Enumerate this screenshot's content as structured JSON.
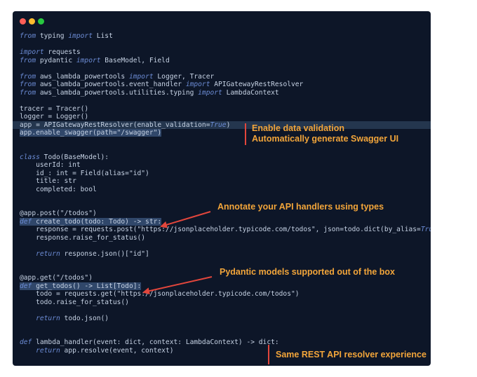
{
  "colors": {
    "red_dot": "#ff5f57",
    "yellow_dot": "#febc2e",
    "green_dot": "#28c840",
    "annotation": "#f2a53a",
    "marker": "#e2463c"
  },
  "code_lines": [
    {
      "segs": [
        [
          "from",
          "kw"
        ],
        [
          " typing ",
          ""
        ],
        [
          "import",
          "kw"
        ],
        [
          " List",
          ""
        ]
      ]
    },
    {
      "segs": []
    },
    {
      "segs": [
        [
          "import",
          "kw"
        ],
        [
          " requests",
          ""
        ]
      ]
    },
    {
      "segs": [
        [
          "from",
          "kw"
        ],
        [
          " pydantic ",
          ""
        ],
        [
          "import",
          "kw"
        ],
        [
          " BaseModel, Field",
          ""
        ]
      ]
    },
    {
      "segs": []
    },
    {
      "segs": [
        [
          "from",
          "kw"
        ],
        [
          " aws_lambda_powertools ",
          ""
        ],
        [
          "import",
          "kw"
        ],
        [
          " Logger, Tracer",
          ""
        ]
      ]
    },
    {
      "segs": [
        [
          "from",
          "kw"
        ],
        [
          " aws_lambda_powertools.event_handler ",
          ""
        ],
        [
          "import",
          "kw"
        ],
        [
          " APIGatewayRestResolver",
          ""
        ]
      ]
    },
    {
      "segs": [
        [
          "from",
          "kw"
        ],
        [
          " aws_lambda_powertools.utilities.typing ",
          ""
        ],
        [
          "import",
          "kw"
        ],
        [
          " LambdaContext",
          ""
        ]
      ]
    },
    {
      "segs": []
    },
    {
      "segs": [
        [
          "tracer = Tracer()",
          ""
        ]
      ]
    },
    {
      "segs": [
        [
          "logger = Logger()",
          ""
        ]
      ]
    },
    {
      "segs": [
        [
          "app = APIGatewayRestResolver(enable_validation=",
          ""
        ],
        [
          "True",
          "bool"
        ],
        [
          ")",
          ""
        ]
      ],
      "highlight": true
    },
    {
      "segs": [
        [
          "app.enable_swagger(path=\"/swagger\")",
          "hlseg"
        ]
      ]
    },
    {
      "segs": []
    },
    {
      "segs": []
    },
    {
      "segs": [
        [
          "class",
          "kw"
        ],
        [
          " Todo(BaseModel):",
          ""
        ]
      ]
    },
    {
      "segs": [
        [
          "    userId: int",
          ""
        ]
      ]
    },
    {
      "segs": [
        [
          "    id_: int = Field(alias=\"id\")",
          ""
        ]
      ]
    },
    {
      "segs": [
        [
          "    title: str",
          ""
        ]
      ]
    },
    {
      "segs": [
        [
          "    completed: bool",
          ""
        ]
      ]
    },
    {
      "segs": []
    },
    {
      "segs": []
    },
    {
      "segs": [
        [
          "@app.post(\"/todos\")",
          ""
        ]
      ]
    },
    {
      "segs": [
        [
          "def",
          "kw hlseg"
        ],
        [
          " create_todo(todo: Todo) -> str:",
          "hlseg"
        ]
      ]
    },
    {
      "segs": [
        [
          "    response = requests.post(\"https://jsonplaceholder.typicode.com/todos\", json=todo.dict(by_alias=",
          ""
        ],
        [
          "True",
          "bool"
        ],
        [
          "))",
          ""
        ]
      ]
    },
    {
      "segs": [
        [
          "    response.raise_for_status()",
          ""
        ]
      ]
    },
    {
      "segs": []
    },
    {
      "segs": [
        [
          "    ",
          ""
        ],
        [
          "return",
          "kw"
        ],
        [
          " response.json()[\"id\"]",
          ""
        ]
      ]
    },
    {
      "segs": []
    },
    {
      "segs": []
    },
    {
      "segs": [
        [
          "@app.get(\"/todos\")",
          ""
        ]
      ]
    },
    {
      "segs": [
        [
          "def",
          "kw hlseg"
        ],
        [
          " get_todos() -> List[Todo]:",
          "hlseg"
        ]
      ]
    },
    {
      "segs": [
        [
          "    todo = requests.get(\"https://jsonplaceholder.typicode.com/todos\")",
          ""
        ]
      ]
    },
    {
      "segs": [
        [
          "    todo.raise_for_status()",
          ""
        ]
      ]
    },
    {
      "segs": []
    },
    {
      "segs": [
        [
          "    ",
          ""
        ],
        [
          "return",
          "kw"
        ],
        [
          " todo.json()",
          ""
        ]
      ]
    },
    {
      "segs": []
    },
    {
      "segs": []
    },
    {
      "segs": [
        [
          "def",
          "kw"
        ],
        [
          " lambda_handler(event: dict, context: LambdaContext) -> dict:",
          ""
        ]
      ]
    },
    {
      "segs": [
        [
          "    ",
          ""
        ],
        [
          "return",
          "kw"
        ],
        [
          " app.resolve(event, context)",
          ""
        ]
      ]
    }
  ],
  "annotations": {
    "validation": "Enable data validation",
    "swagger": "Automatically generate Swagger UI",
    "types": "Annotate your API handlers using types",
    "pydantic": "Pydantic models supported out of the box",
    "resolver": "Same REST API resolver experience"
  }
}
